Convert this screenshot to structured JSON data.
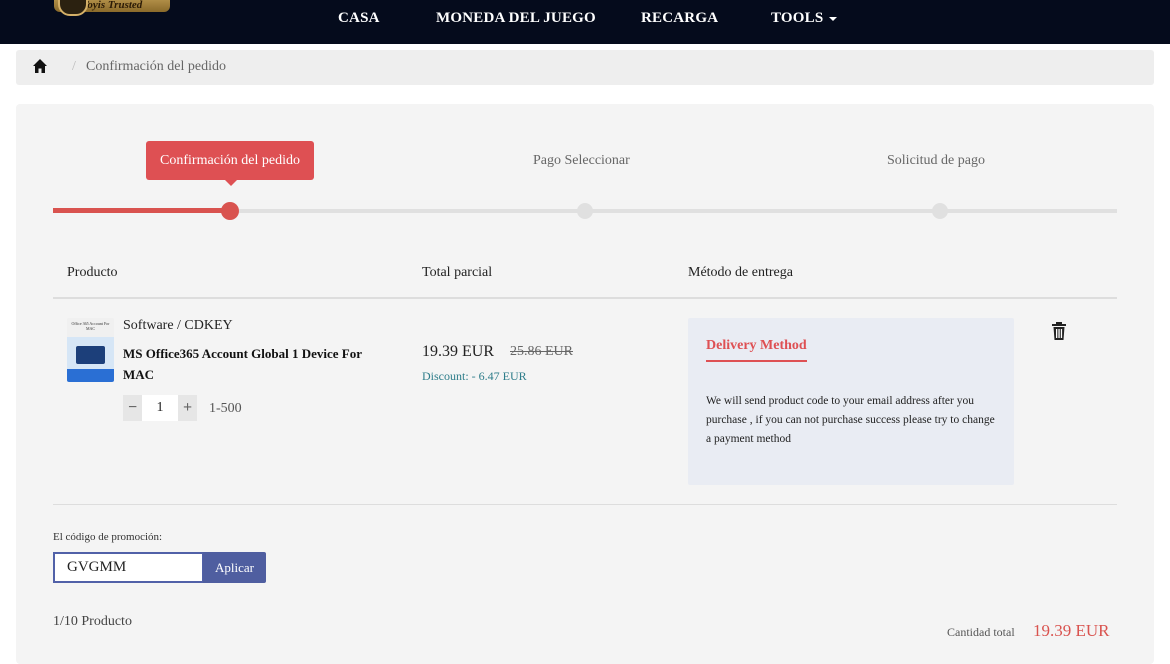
{
  "nav": {
    "logo_text": "Toyis Trusted",
    "items": [
      {
        "label": "CASA"
      },
      {
        "label": "MONEDA DEL JUEGO"
      },
      {
        "label": "RECARGA"
      },
      {
        "label": "TOOLS"
      }
    ]
  },
  "breadcrumb": {
    "separator": "/",
    "current": "Confirmación del pedido"
  },
  "steps": [
    {
      "label": "Confirmación del pedido",
      "state": "active"
    },
    {
      "label": "Pago Seleccionar",
      "state": "inactive"
    },
    {
      "label": "Solicitud de pago",
      "state": "inactive"
    }
  ],
  "progress": {
    "completed_step": 1,
    "total_steps": 3
  },
  "table": {
    "headers": {
      "product": "Producto",
      "subtotal": "Total parcial",
      "delivery": "Método de entrega"
    }
  },
  "product": {
    "thumb_text": "Office 365 Account For MAC",
    "category": "Software / CDKEY",
    "name": "MS Office365 Account Global 1 Device For MAC",
    "quantity": "1",
    "quantity_range": "1-500",
    "decrement": "−",
    "increment": "+",
    "price": "19.39 EUR",
    "old_price": "25.86 EUR",
    "discount": "Discount: - 6.47 EUR"
  },
  "delivery": {
    "title": "Delivery Method",
    "text": "We will send product code to your email address after you purchase , if you can not purchase success please try to change a payment method"
  },
  "promo": {
    "label": "El código de promoción:",
    "value": "GVGMM",
    "button": "Aplicar"
  },
  "summary": {
    "count": "1/10 Producto",
    "total_label": "Cantidad total",
    "total_value": "19.39 EUR"
  },
  "colors": {
    "accent": "#de5053",
    "nav_bg": "#050b1c",
    "button": "#4f5ea0",
    "discount": "#2e7d8a"
  },
  "icons": [
    "home-icon",
    "trash-icon",
    "caret-down-icon"
  ]
}
